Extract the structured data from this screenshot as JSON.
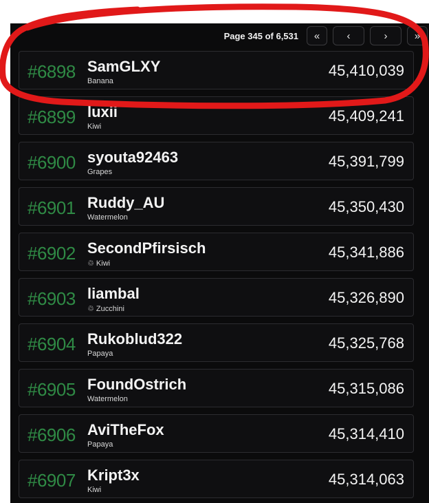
{
  "pager": {
    "label": "Page 345 of 6,531",
    "buttons": [
      {
        "glyph": "«",
        "name": "first-page-button"
      },
      {
        "glyph": "‹",
        "name": "prev-page-button"
      },
      {
        "glyph": "›",
        "name": "next-page-button"
      },
      {
        "glyph": "»",
        "name": "last-page-button"
      }
    ]
  },
  "rows": [
    {
      "rank": "#6898",
      "name": "SamGLXY",
      "fruit": "Banana",
      "score": "45,410,039",
      "icon": ""
    },
    {
      "rank": "#6899",
      "name": "luxii",
      "fruit": "Kiwi",
      "score": "45,409,241",
      "icon": ""
    },
    {
      "rank": "#6900",
      "name": "syouta92463",
      "fruit": "Grapes",
      "score": "45,391,799",
      "icon": ""
    },
    {
      "rank": "#6901",
      "name": "Ruddy_AU",
      "fruit": "Watermelon",
      "score": "45,350,430",
      "icon": ""
    },
    {
      "rank": "#6902",
      "name": "SecondPfirsisch",
      "fruit": "Kiwi",
      "score": "45,341,886",
      "icon": "♲ "
    },
    {
      "rank": "#6903",
      "name": "liambal",
      "fruit": "Zucchini",
      "score": "45,326,890",
      "icon": "♲ "
    },
    {
      "rank": "#6904",
      "name": "Rukoblud322",
      "fruit": "Papaya",
      "score": "45,325,768",
      "icon": ""
    },
    {
      "rank": "#6905",
      "name": "FoundOstrich",
      "fruit": "Watermelon",
      "score": "45,315,086",
      "icon": ""
    },
    {
      "rank": "#6906",
      "name": "AviTheFox",
      "fruit": "Papaya",
      "score": "45,314,410",
      "icon": ""
    },
    {
      "rank": "#6907",
      "name": "Kript3x",
      "fruit": "Kiwi",
      "score": "45,314,063",
      "icon": ""
    }
  ],
  "colors": {
    "rank_green": "#2f8a45",
    "annotation_red": "#e11919",
    "panel_bg": "#0b0b0c"
  }
}
